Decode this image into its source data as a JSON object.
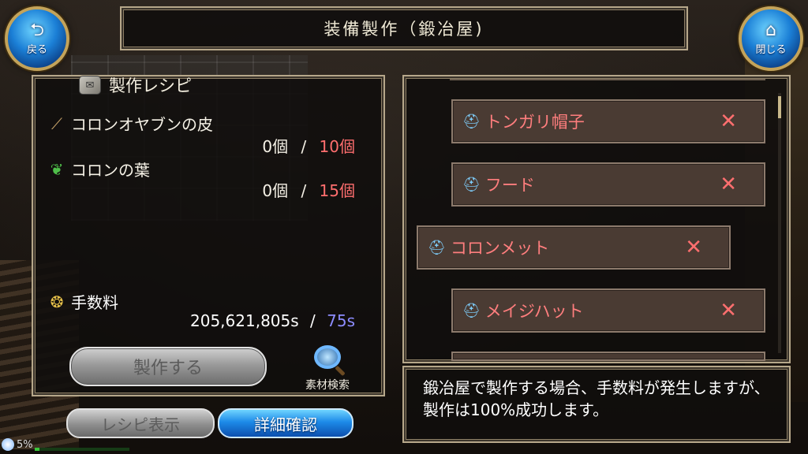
{
  "header": {
    "title": "装備製作（鍛冶屋)",
    "back_label": "戻る",
    "close_label": "閉じる"
  },
  "recipe": {
    "heading": "製作レシピ",
    "materials": [
      {
        "name": "コロンオヤブンの皮",
        "have": "0個",
        "sep": "/",
        "need": "10個",
        "icon": "leather-icon"
      },
      {
        "name": "コロンの葉",
        "have": "0個",
        "sep": "/",
        "need": "15個",
        "icon": "leaf-icon"
      }
    ],
    "fee_label": "手数料",
    "fee_owned": "205,621,805s",
    "fee_sep": "/",
    "fee_cost": "75s",
    "craft_button": "製作する",
    "search_label": "素材検索",
    "recipe_view_button": "レシピ表示",
    "detail_button": "詳細確認"
  },
  "equipment_list": [
    {
      "name": "トンガリ帽子",
      "craftable": false
    },
    {
      "name": "フード",
      "craftable": false
    },
    {
      "name": "コロンメット",
      "craftable": false,
      "selected": true
    },
    {
      "name": "メイジハット",
      "craftable": false
    }
  ],
  "mark_cross": "✕",
  "message": "鍛冶屋で製作する場合、手数料が発生しますが、製作は100%成功します。",
  "stamina": {
    "text": "5%",
    "fraction": 0.05
  },
  "colors": {
    "insufficient": "#ff6e6e",
    "cost": "#8d8cff",
    "accent": "#1d8ae8"
  }
}
